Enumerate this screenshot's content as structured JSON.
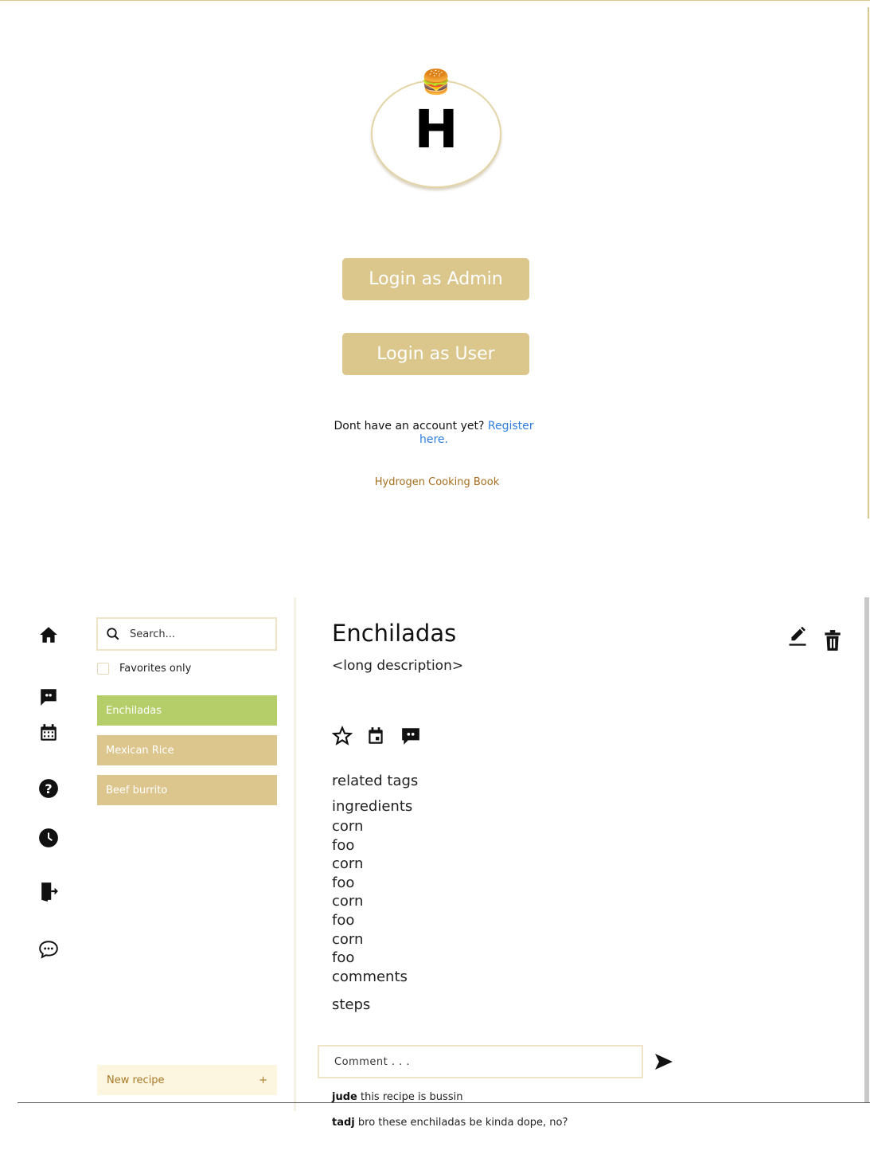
{
  "login": {
    "logo_emoji": "🍔",
    "logo_letter": "H",
    "admin_button": "Login as Admin",
    "user_button": "Login as User",
    "register_prompt": "Dont have an account yet?",
    "register_link": "Register here.",
    "footer": "Hydrogen Cooking Book"
  },
  "nav": {
    "icons": [
      "home-icon",
      "chat-icon",
      "calendar-icon",
      "help-icon",
      "clock-icon",
      "logout-icon",
      "chat-bubble-icon"
    ]
  },
  "sidebar": {
    "search_placeholder": "Search...",
    "favorites_label": "Favorites only",
    "recipes": [
      {
        "name": "Enchiladas",
        "active": true
      },
      {
        "name": "Mexican Rice",
        "active": false
      },
      {
        "name": "Beef burrito",
        "active": false
      }
    ],
    "new_recipe_label": "New recipe",
    "new_recipe_plus": "+"
  },
  "recipe": {
    "title": "Enchiladas",
    "description": "<long description>",
    "related_tags_title": "related tags",
    "ingredients_title": "ingredients",
    "ingredients": [
      "corn",
      "foo",
      "corn",
      "foo",
      "corn",
      "foo",
      "corn",
      "foo"
    ],
    "comments_title": "comments",
    "steps_title": "steps"
  },
  "comments": {
    "placeholder": "Comment . . .",
    "items": [
      {
        "user": "jude",
        "text": "this recipe is bussin"
      },
      {
        "user": "tadj",
        "text": "bro these enchiladas be kinda dope, no?"
      }
    ]
  },
  "colors": {
    "accent_gold": "#dbc68b",
    "active_green": "#b5ce6a",
    "link_blue": "#2f7de1",
    "footer_brown": "#a66d1e"
  }
}
